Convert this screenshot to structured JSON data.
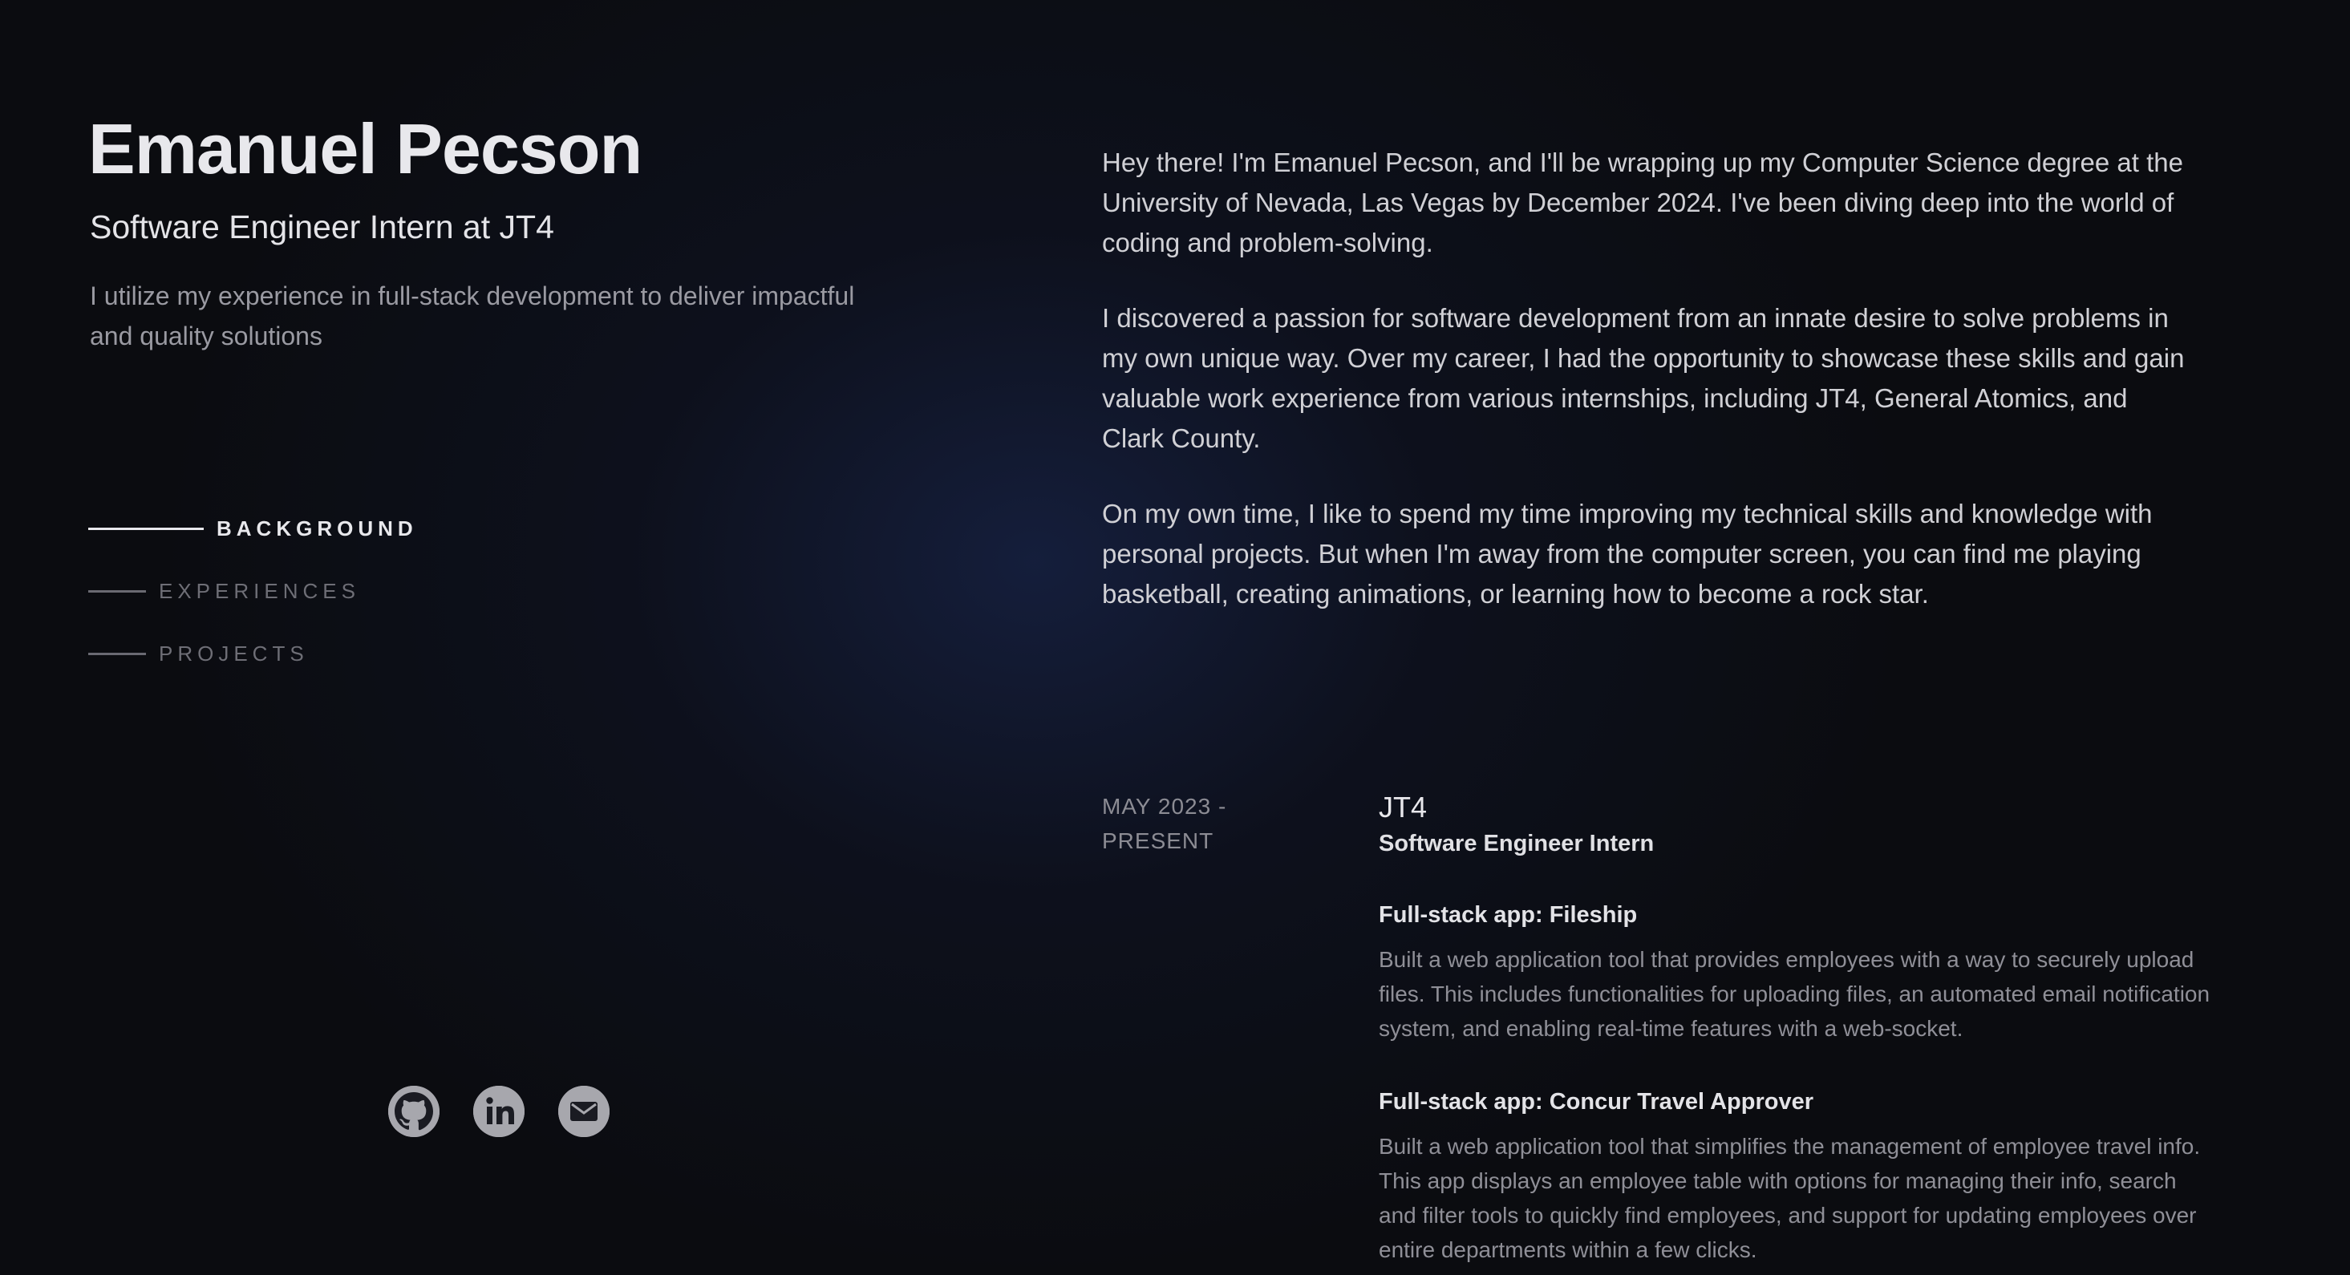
{
  "header": {
    "name": "Emanuel Pecson",
    "role": "Software Engineer Intern at JT4",
    "tagline": "I utilize my experience in full-stack development to deliver impactful and quality solutions"
  },
  "nav": {
    "items": [
      {
        "label": "BACKGROUND",
        "active": true
      },
      {
        "label": "EXPERIENCES",
        "active": false
      },
      {
        "label": "PROJECTS",
        "active": false
      }
    ]
  },
  "socials": {
    "items": [
      {
        "icon": "github-icon"
      },
      {
        "icon": "linkedin-icon"
      },
      {
        "icon": "mail-icon"
      }
    ]
  },
  "about": {
    "paragraphs": [
      "Hey there! I'm Emanuel Pecson, and I'll be wrapping up my Computer Science degree at the University of Nevada, Las Vegas by December 2024. I've been diving deep into the world of coding and problem-solving.",
      "I discovered a passion for software development from an innate desire to solve problems in my own unique way. Over my career, I had the opportunity to showcase these skills and gain valuable work experience from various internships, including JT4, General Atomics, and Clark County.",
      "On my own time, I like to spend my time improving my technical skills and knowledge with personal projects. But when I'm away from the computer screen, you can find me playing basketball, creating animations, or learning how to become a rock star."
    ]
  },
  "experience": {
    "date": "MAY 2023 - PRESENT",
    "company": "JT4",
    "position": "Software Engineer Intern",
    "projects": [
      {
        "title": "Full-stack app: Fileship",
        "description": "Built a web application tool that provides employees with a way to securely upload files. This includes functionalities for uploading files, an automated email notification system, and enabling real-time features with a web-socket."
      },
      {
        "title": "Full-stack app: Concur Travel Approver",
        "description": "Built a web application tool that simplifies the management of employee travel info. This app displays an employee table with options for managing their info, search and filter tools to quickly find employees, and support for updating employees over entire departments within a few clicks."
      }
    ]
  },
  "colors": {
    "background": "#0b0c10",
    "accent_glow": "#18244a",
    "text_primary": "#e8e8ec",
    "text_muted": "#8f8f97"
  }
}
